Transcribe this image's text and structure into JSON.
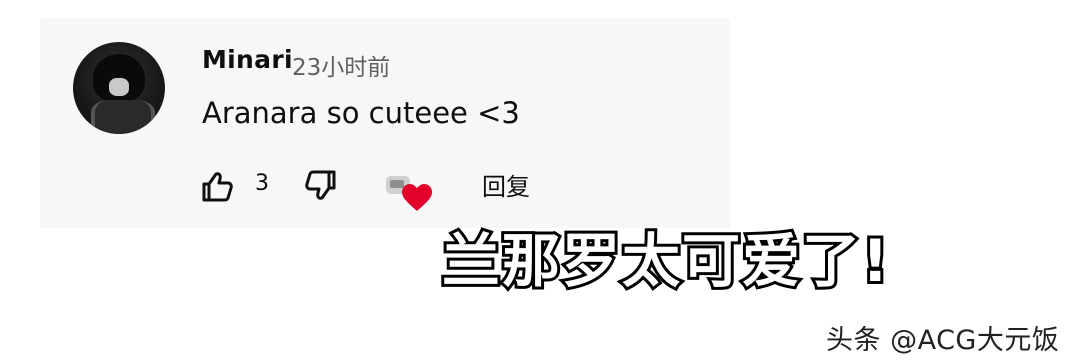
{
  "comment": {
    "author": "Minari",
    "time": "23小时前",
    "text": "Aranara so cuteee <3",
    "likes": "3",
    "reply_label": "回复"
  },
  "icons": {
    "like": "thumb-up-icon",
    "dislike": "thumb-down-icon",
    "creator_heart": "creator-heart-icon"
  },
  "caption": "兰那罗太可爱了!",
  "watermark": "头条 @ACG大元饭",
  "colors": {
    "card_bg": "#f7f7f7",
    "heart": "#e3002b",
    "text": "#0f0f0f",
    "muted": "#606060"
  }
}
